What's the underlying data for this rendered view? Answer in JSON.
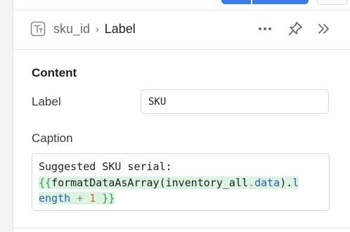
{
  "header": {
    "component_name": "sku_id",
    "separator": "›",
    "current_property": "Label",
    "icons": {
      "component": "text-component-icon",
      "more": "more-horizontal-icon",
      "pin": "pin-icon",
      "collapse": "double-chevron-right-icon"
    }
  },
  "content": {
    "section_title": "Content",
    "label_field": {
      "label": "Label",
      "value": "SKU"
    },
    "caption_field": {
      "label": "Caption",
      "line1": "Suggested SKU serial:",
      "line2_open": "{{",
      "line2_fn": "formatDataAsArray(inventory_all",
      "line2_dot": ".",
      "line2_prop": "data",
      "line2_close_paren": ").",
      "line2_prop2": "l",
      "line3_prop": "ength",
      "line3_op": " + ",
      "line3_num": "1",
      "line3_close": " }}"
    }
  },
  "colors": {
    "accent": "#3d7be8",
    "template_highlight": "#ddf3e2",
    "brace": "#2e9a4b",
    "property": "#2e5db3",
    "number": "#d9652b"
  }
}
